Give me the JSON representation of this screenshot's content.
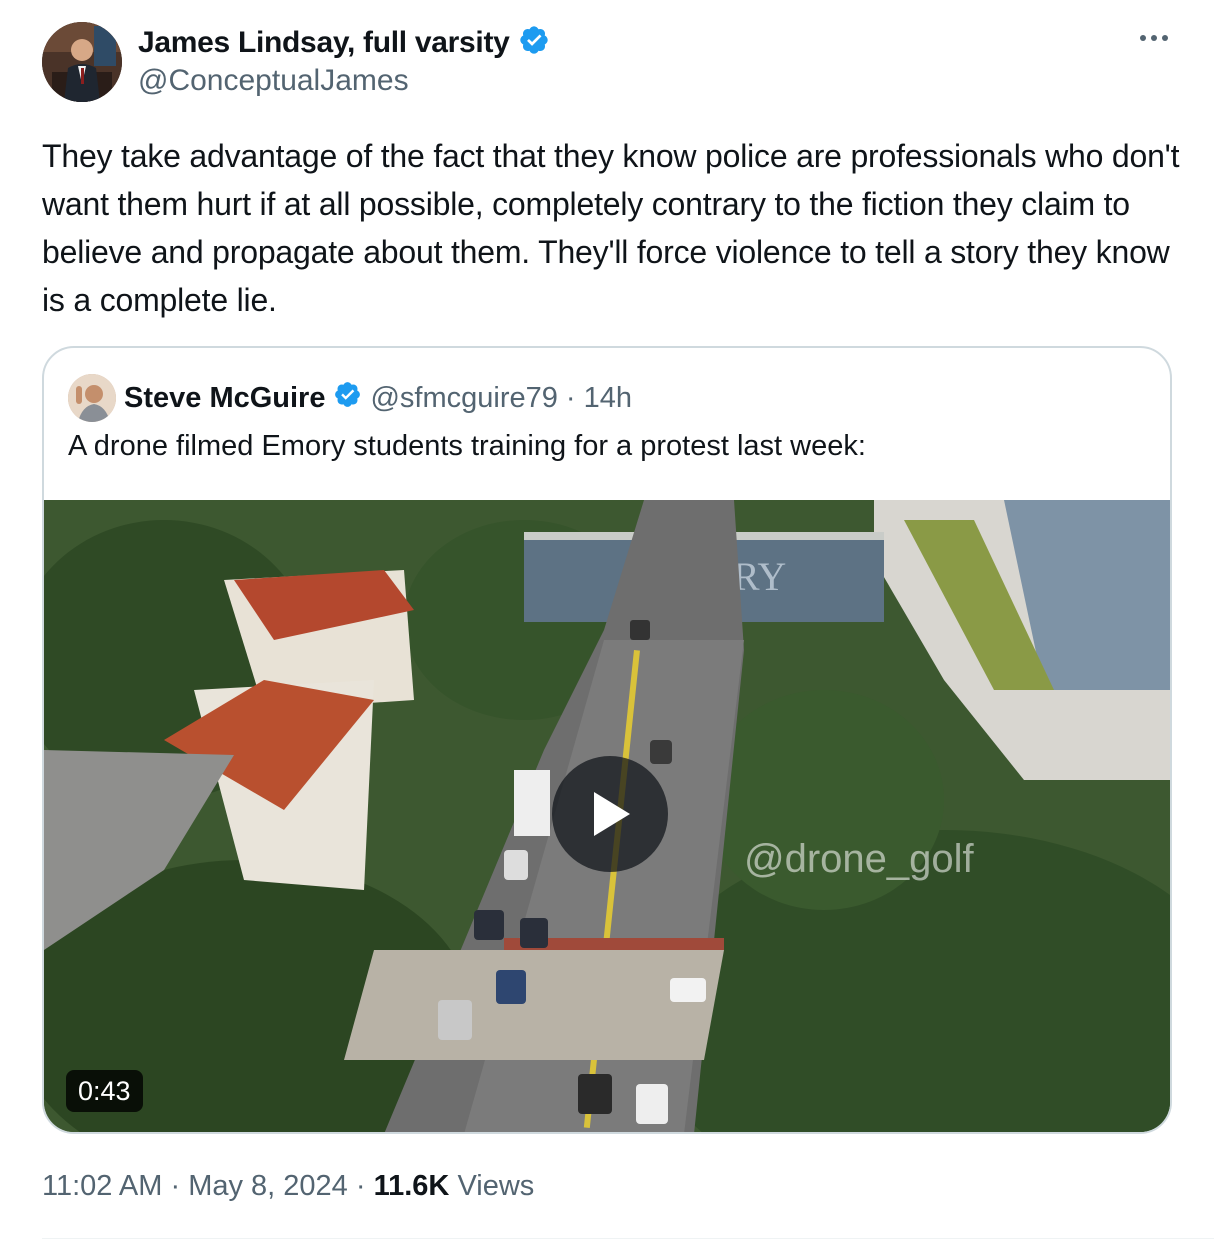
{
  "author": {
    "name": "James Lindsay, full varsity",
    "handle": "@ConceptualJames",
    "verified": true
  },
  "tweet_text": "They take advantage of the fact that they know police are professionals who don't want them hurt if at all possible, completely contrary to the fiction they claim to believe and propagate about them. They'll force violence to tell a story they know is a complete lie.",
  "quoted": {
    "name": "Steve McGuire",
    "handle": "@sfmcguire79",
    "separator": "·",
    "time": "14h",
    "text": "A drone filmed Emory students training for a protest last week:",
    "video": {
      "duration": "0:43",
      "sign_text": "EMORY",
      "watermark": "@drone_golf"
    }
  },
  "footer": {
    "time": "11:02 AM",
    "sep1": "·",
    "date": "May 8, 2024",
    "sep2": "·",
    "views_count": "11.6K",
    "views_label": "Views"
  },
  "colors": {
    "verified_blue": "#1d9bf0",
    "muted": "#536471",
    "border": "#cfd9de"
  },
  "icons": [
    "verified-badge-icon",
    "more-options-icon",
    "play-icon"
  ]
}
